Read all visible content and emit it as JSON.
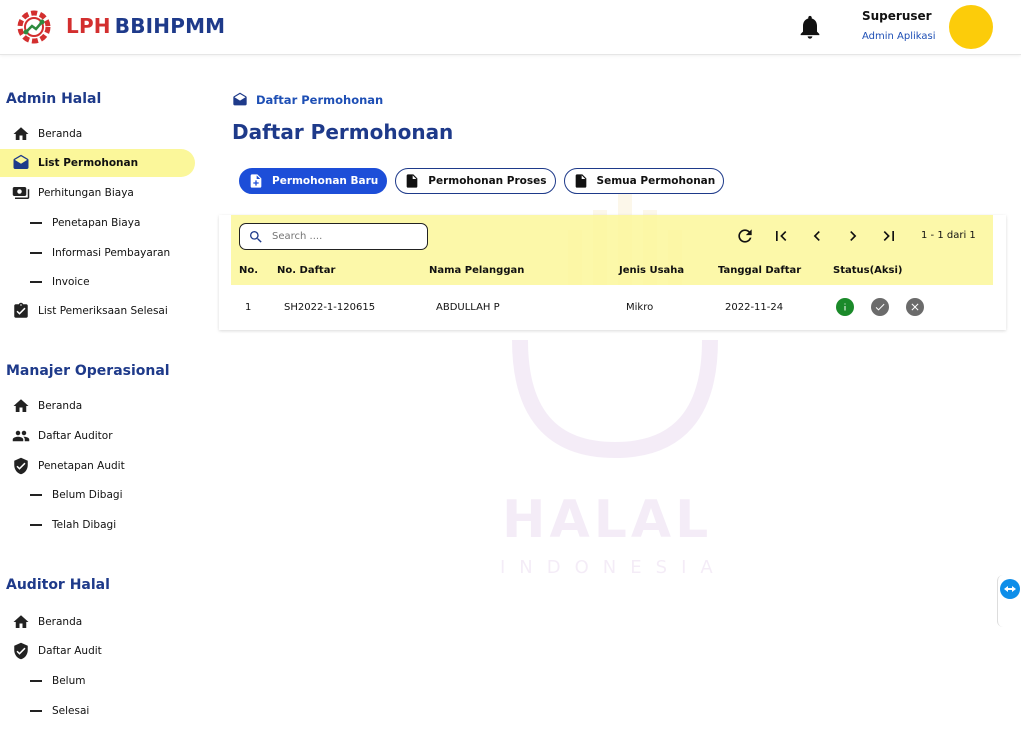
{
  "header": {
    "brand_part1": "LPH",
    "brand_part2": "BBIHPMM",
    "user_name": "Superuser",
    "user_role": "Admin Aplikasi",
    "icons": [
      "logo-icon",
      "bell-icon"
    ],
    "colors": {
      "brand_red": "#d32f2f",
      "brand_blue": "#1e3a8a",
      "avatar": "#fccc0a"
    }
  },
  "sidebar": {
    "admin_halal": {
      "title": "Admin Halal",
      "items": [
        {
          "label": "Beranda",
          "icon": "home-icon"
        },
        {
          "label": "List Permohonan",
          "icon": "mail-open-icon",
          "active": true
        },
        {
          "label": "Perhitungan Biaya",
          "icon": "money-icon"
        },
        {
          "label": "Penetapan Biaya",
          "sub": true
        },
        {
          "label": "Informasi Pembayaran",
          "sub": true
        },
        {
          "label": "Invoice",
          "sub": true
        },
        {
          "label": "List Pemeriksaan Selesai",
          "icon": "clipboard-check-icon"
        }
      ]
    },
    "manajer_operasional": {
      "title": "Manajer Operasional",
      "items": [
        {
          "label": "Beranda",
          "icon": "home-icon"
        },
        {
          "label": "Daftar Auditor",
          "icon": "people-icon"
        },
        {
          "label": "Penetapan Audit",
          "icon": "shield-check-icon"
        },
        {
          "label": "Belum Dibagi",
          "sub": true
        },
        {
          "label": "Telah Dibagi",
          "sub": true
        }
      ]
    },
    "auditor_halal": {
      "title": "Auditor Halal",
      "items": [
        {
          "label": "Beranda",
          "icon": "home-icon"
        },
        {
          "label": "Daftar Audit",
          "icon": "shield-check-icon"
        },
        {
          "label": "Belum",
          "sub": true
        },
        {
          "label": "Selesai",
          "sub": true
        }
      ]
    }
  },
  "main": {
    "breadcrumb": "Daftar Permohonan",
    "title": "Daftar Permohonan",
    "tabs": [
      {
        "label": "Permohonan Baru",
        "active": true
      },
      {
        "label": "Permohonan Proses"
      },
      {
        "label": "Semua Permohonan"
      }
    ],
    "search": {
      "placeholder": "Search ....",
      "value": ""
    },
    "pager": {
      "info": "1 - 1 dari 1"
    },
    "columns": [
      "No.",
      "No. Daftar",
      "Nama Pelanggan",
      "Jenis Usaha",
      "Tanggal Daftar",
      "Status(Aksi)"
    ],
    "rows": [
      {
        "no": "1",
        "no_daftar": "SH2022-1-120615",
        "nama": "ABDULLAH P",
        "jenis": "Mikro",
        "tanggal": "2022-11-24"
      }
    ],
    "row_actions": [
      "info-icon",
      "check-icon",
      "close-icon"
    ],
    "colors": {
      "toolbar_bg": "#fbf79a",
      "accent": "#1d4ed8",
      "info_green": "#1b8a2a",
      "action_grey": "#6b6b6b"
    }
  },
  "watermark": {
    "line1": "HALAL",
    "line2": "INDONESIA"
  }
}
